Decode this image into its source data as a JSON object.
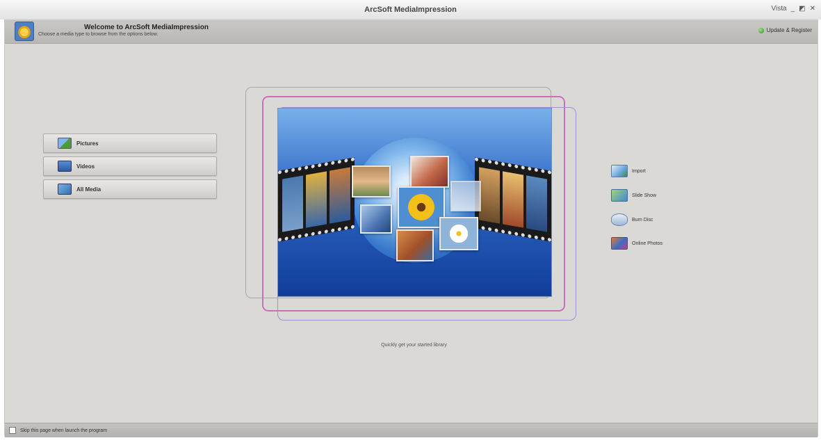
{
  "window": {
    "title": "ArcSoft MediaImpression",
    "controls": [
      "Vista",
      "_",
      "◩",
      "✕"
    ]
  },
  "header": {
    "welcome_title": "Welcome to ArcSoft MediaImpression",
    "welcome_subtitle": "Choose a media type to browse from the options below.",
    "support_label": "Update & Register"
  },
  "menu": {
    "items": [
      {
        "label": "Pictures",
        "icon": "pictures-icon"
      },
      {
        "label": "Videos",
        "icon": "videos-icon"
      },
      {
        "label": "All Media",
        "icon": "all-media-icon"
      }
    ]
  },
  "preview": {
    "caption": "Quickly get your started library"
  },
  "actions": {
    "items": [
      {
        "label": "Import",
        "icon": "import-icon"
      },
      {
        "label": "Slide Show",
        "icon": "slideshow-icon"
      },
      {
        "label": "Burn Disc",
        "icon": "burn-disc-icon"
      },
      {
        "label": "Online Photos",
        "icon": "online-photos-icon"
      }
    ]
  },
  "footer": {
    "startup_label": "Skip this page when launch the program"
  }
}
